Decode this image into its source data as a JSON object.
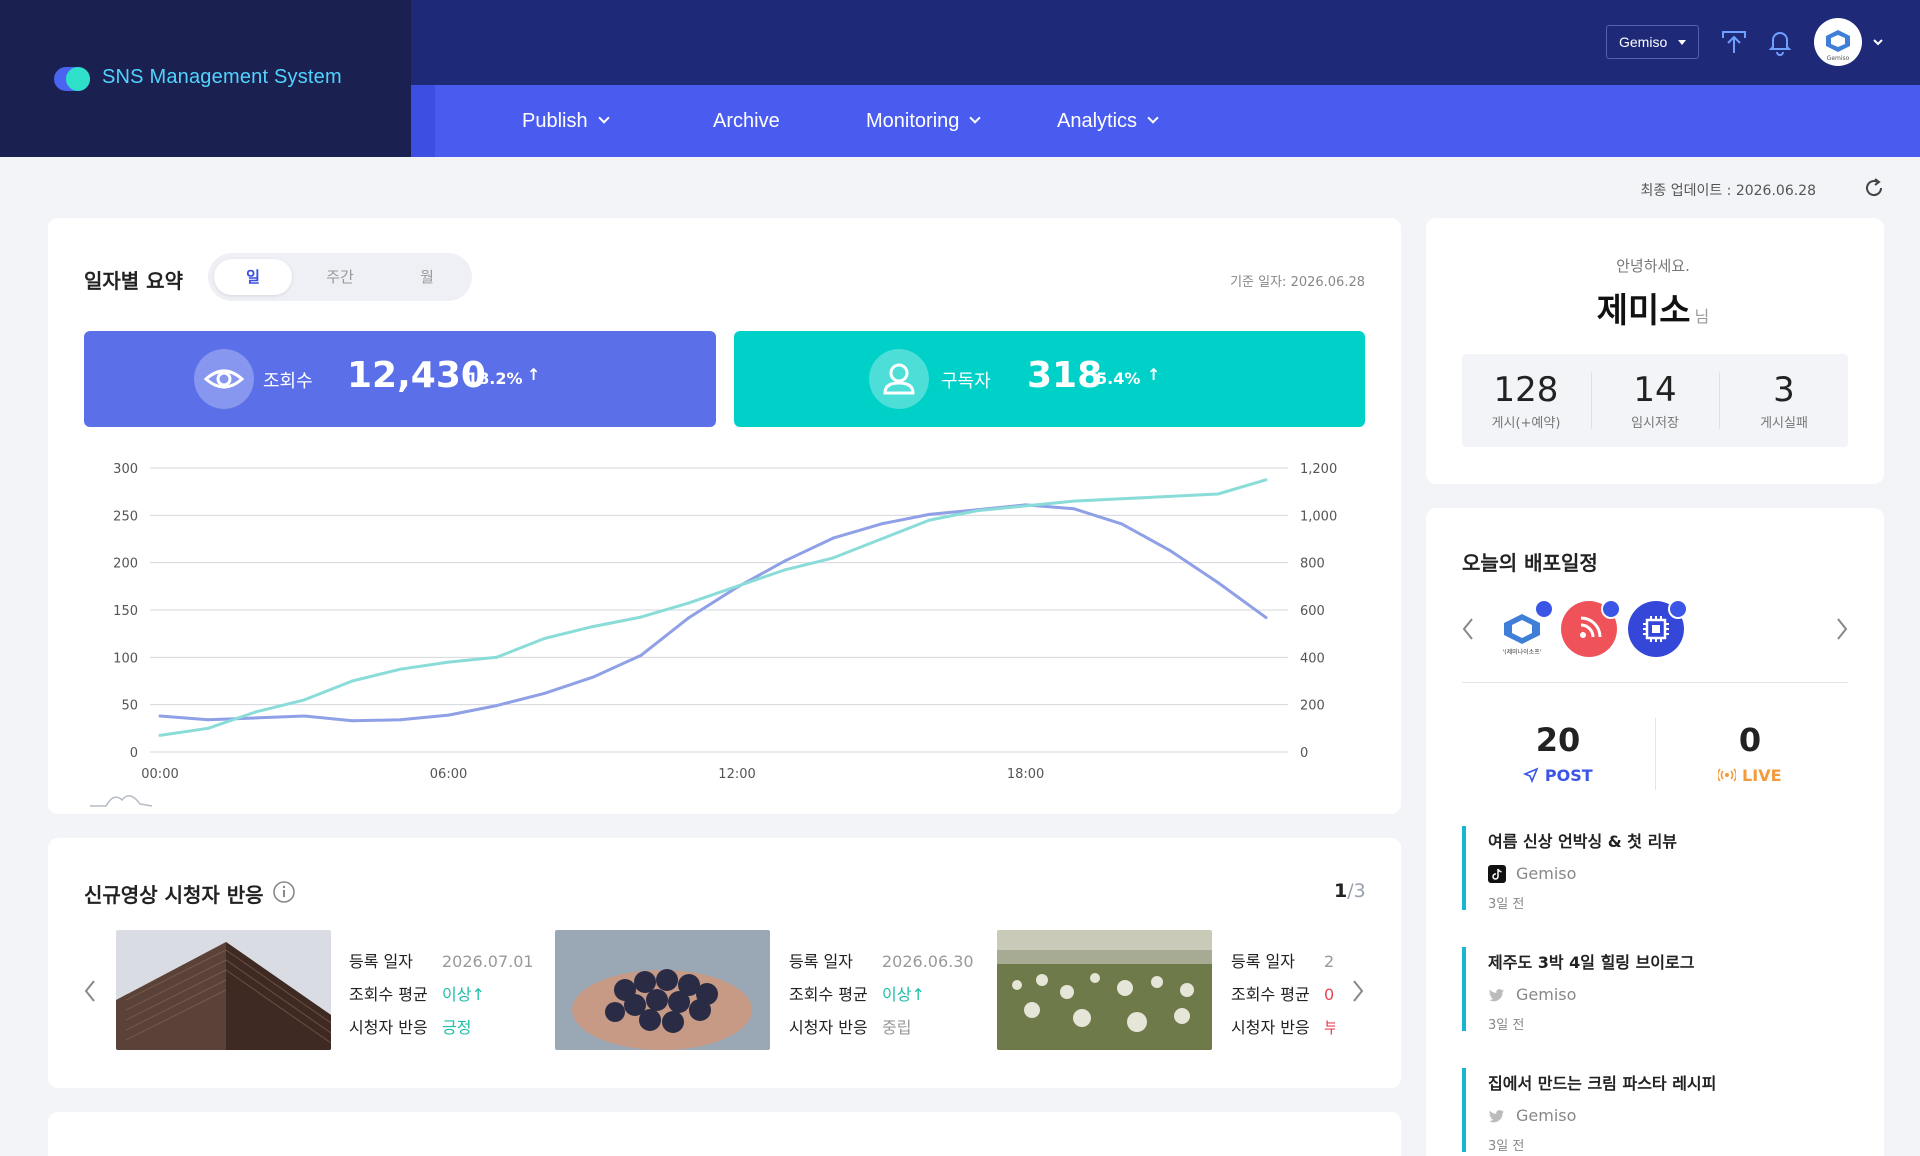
{
  "app": {
    "title": "SNS Management System"
  },
  "header": {
    "workspace": "Gemiso",
    "avatar_label": "Gemiso"
  },
  "nav": {
    "items": [
      {
        "label": "Publish",
        "has_dropdown": true
      },
      {
        "label": "Archive",
        "has_dropdown": false
      },
      {
        "label": "Monitoring",
        "has_dropdown": true
      },
      {
        "label": "Analytics",
        "has_dropdown": true
      }
    ]
  },
  "last_update": "최종 업데이트 : 2026.06.28",
  "daily_summary": {
    "title": "일자별 요약",
    "tabs": [
      "일",
      "주간",
      "월"
    ],
    "active_tab": "일",
    "base_date": "기준 일자: 2026.06.28",
    "views": {
      "label": "조회수",
      "value": "12,430",
      "delta": "18.2%",
      "direction": "↑",
      "color": "#5b6fe8"
    },
    "subscribers": {
      "label": "구독자",
      "value": "318",
      "delta": "5.4%",
      "direction": "↑",
      "color": "#00d1c8"
    }
  },
  "chart_data": {
    "type": "line",
    "x": [
      "00:00",
      "01:00",
      "02:00",
      "03:00",
      "04:00",
      "05:00",
      "06:00",
      "07:00",
      "08:00",
      "09:00",
      "10:00",
      "11:00",
      "12:00",
      "13:00",
      "14:00",
      "15:00",
      "16:00",
      "17:00",
      "18:00",
      "19:00",
      "20:00",
      "21:00",
      "22:00",
      "23:00"
    ],
    "x_tick_labels": [
      "00:00",
      "06:00",
      "12:00",
      "18:00"
    ],
    "series": [
      {
        "axis": "left",
        "color": "#8fa0e6",
        "values": [
          38,
          34,
          36,
          38,
          33,
          34,
          39,
          49,
          62,
          79,
          102,
          142,
          174,
          202,
          226,
          241,
          251,
          256,
          261,
          257,
          241,
          213,
          179,
          142
        ]
      },
      {
        "axis": "right",
        "color": "#8adcd9",
        "values": [
          70,
          100,
          170,
          220,
          300,
          350,
          380,
          400,
          480,
          530,
          570,
          630,
          700,
          770,
          820,
          900,
          980,
          1020,
          1040,
          1060,
          1070,
          1080,
          1090,
          1150
        ]
      }
    ],
    "y_left": {
      "ticks": [
        "0",
        "50",
        "100",
        "150",
        "200",
        "250",
        "300"
      ],
      "lim": [
        0,
        300
      ]
    },
    "y_right": {
      "ticks": [
        "0",
        "200",
        "400",
        "600",
        "800",
        "1,000",
        "1,200"
      ],
      "lim": [
        0,
        1200
      ]
    },
    "grid": true
  },
  "new_videos": {
    "title": "신규영상 시청자 반응",
    "page_current": "1",
    "page_total": "/3",
    "field_labels": {
      "date": "등록 일자",
      "avg": "조회수 평균",
      "reaction": "시청자 반응"
    },
    "items": [
      {
        "image": "building",
        "date": "2026.07.01",
        "avg": "이상↑",
        "avg_color": "#1fbfa8",
        "reaction": "긍정",
        "reaction_color": "#1fbfa8"
      },
      {
        "image": "grapes",
        "date": "2026.06.30",
        "avg": "이상↑",
        "avg_color": "#1fbfa8",
        "reaction": "중립",
        "reaction_color": "#999999"
      },
      {
        "image": "dandelions",
        "date": "2",
        "avg": "0",
        "avg_color": "#e8465a",
        "reaction": "부",
        "reaction_color": "#e8465a"
      }
    ]
  },
  "greeting": {
    "hello": "안녕하세요.",
    "name": "제미소",
    "suffix": "님",
    "stats": [
      {
        "value": "128",
        "label": "게시(+예약)"
      },
      {
        "value": "14",
        "label": "임시저장"
      },
      {
        "value": "3",
        "label": "게시실패"
      }
    ]
  },
  "schedule": {
    "title": "오늘의 배포일정",
    "channels": [
      {
        "name": "gemiso-channel-icon",
        "caption": "'(제미나이소프'"
      },
      {
        "name": "rss-channel-icon"
      },
      {
        "name": "chip-channel-icon"
      }
    ],
    "post_count": "20",
    "post_label": "POST",
    "live_count": "0",
    "live_label": "LIVE",
    "posts": [
      {
        "title": "여름 신상 언박싱 & 첫 리뷰",
        "source": "Gemiso",
        "platform": "tiktok",
        "ago": "3일 전"
      },
      {
        "title": "제주도 3박 4일 힐링 브이로그",
        "source": "Gemiso",
        "platform": "twitter",
        "ago": "3일 전"
      },
      {
        "title": "집에서 만드는 크림 파스타 레시피",
        "source": "Gemiso",
        "platform": "twitter",
        "ago": "3일 전"
      }
    ]
  }
}
